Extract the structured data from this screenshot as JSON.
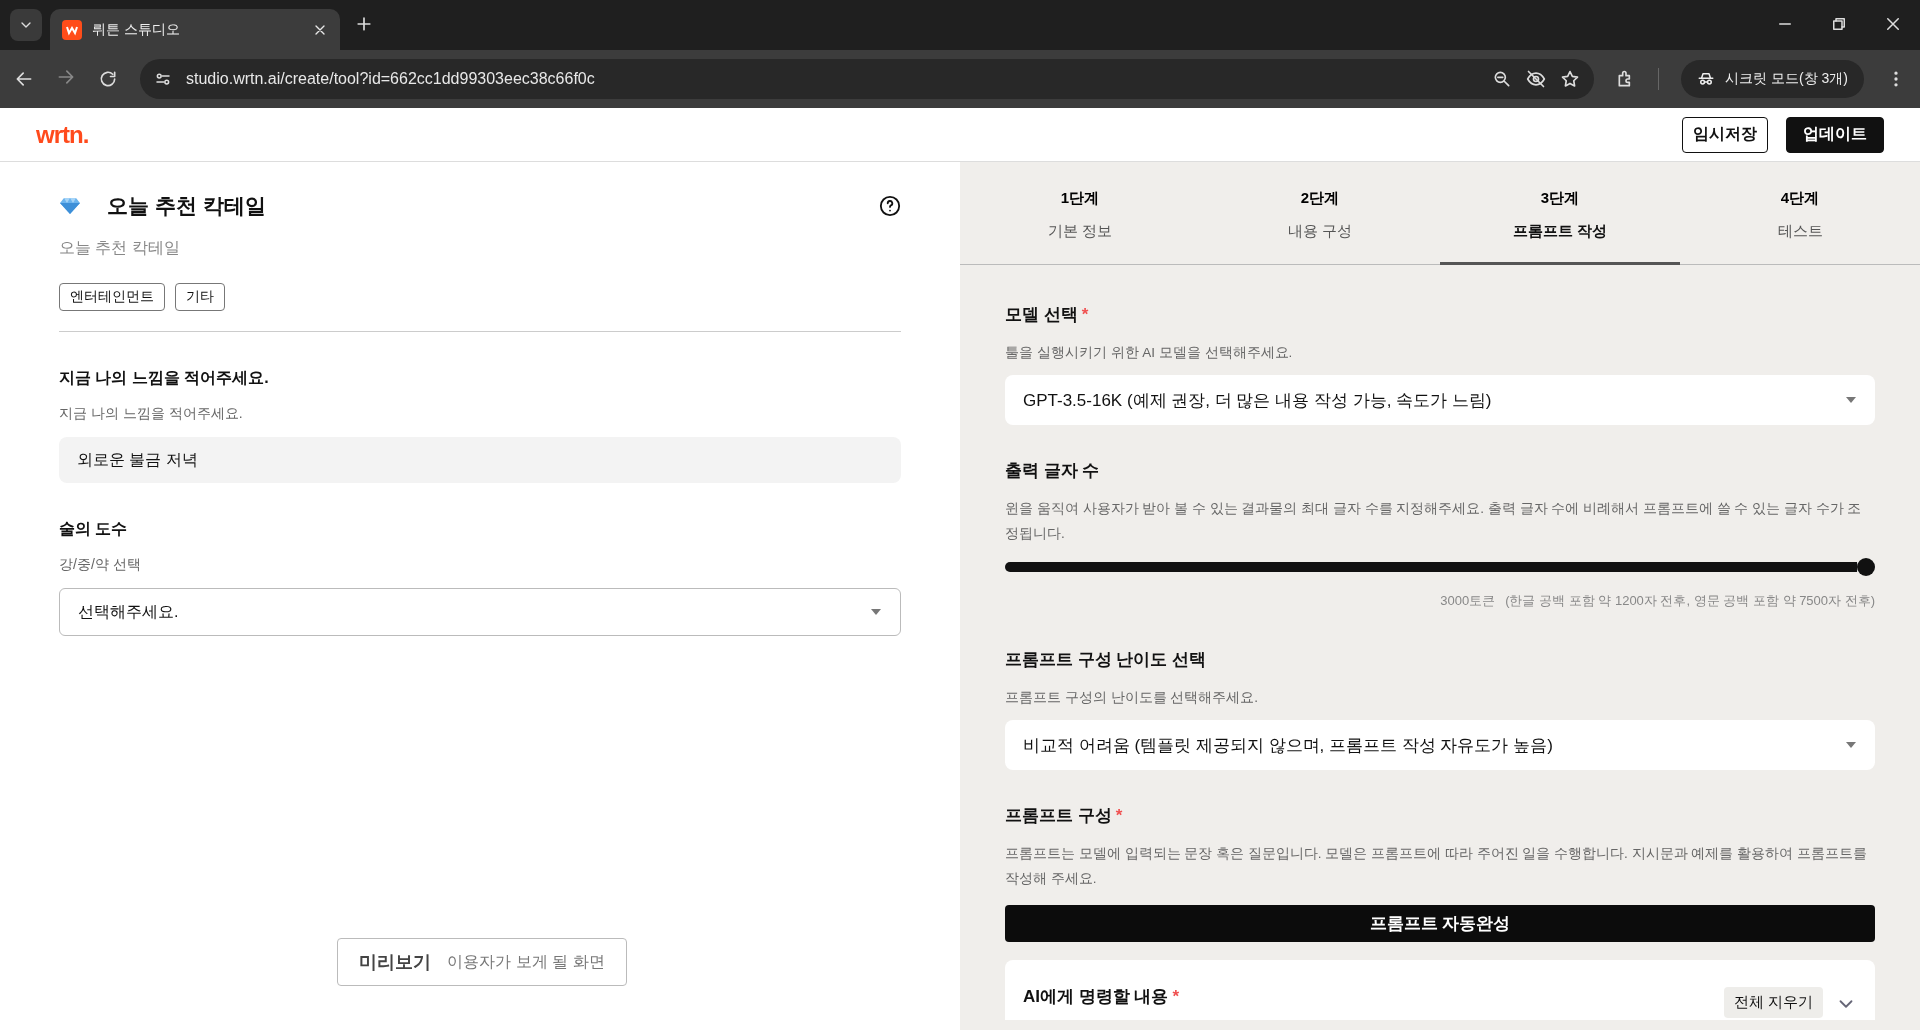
{
  "browser": {
    "tab_title": "뤼튼 스튜디오",
    "url": "studio.wrtn.ai/create/tool?id=662cc1dd99303eec38c66f0c",
    "incognito": "시크릿 모드(창 3개)"
  },
  "header": {
    "logo": "wrtn.",
    "buttons": [
      {
        "label": "임시저장",
        "kind": "outline"
      },
      {
        "label": "업데이트",
        "kind": "solid"
      }
    ]
  },
  "tool": {
    "title": "오늘 추천 칵테일",
    "subtitle": "오늘 추천 칵테일",
    "tags": [
      "엔터테인먼트",
      "기타"
    ],
    "fields": [
      {
        "kind": "text",
        "label": "지금 나의 느낌을 적어주세요.",
        "hint": "지금 나의 느낌을 적어주세요.",
        "value": "외로운 불금 저녁"
      },
      {
        "kind": "select",
        "label": "술의 도수",
        "hint": "강/중/약 선택",
        "placeholder": "선택해주세요."
      }
    ],
    "preview": {
      "label": "미리보기",
      "hint": "이용자가 보게 될 화면"
    }
  },
  "steps": [
    {
      "step": "1단계",
      "name": "기본 정보",
      "selected": false
    },
    {
      "step": "2단계",
      "name": "내용 구성",
      "selected": false
    },
    {
      "step": "3단계",
      "name": "프롬프트 작성",
      "selected": true
    },
    {
      "step": "4단계",
      "name": "테스트",
      "selected": false
    }
  ],
  "model": {
    "label": "모델 선택",
    "required_mark": "*",
    "hint": "툴을 실행시키기 위한 AI 모델을 선택해주세요.",
    "value": "GPT-3.5-16K (예제 권장, 더 많은 내용 작성 가능, 속도가 느림)"
  },
  "output_length": {
    "label": "출력 글자 수",
    "hint": "윈을 움직여 사용자가 받아 볼 수 있는 결과물의 최대 글자 수를 지정해주세요. 출력 글자 수에 비례해서 프롬프트에 쓸 수 있는 글자 수가 조정됩니다.",
    "level": 1,
    "reading": "3000토큰",
    "reading_note": "(한글 공백 포함 약 1200자 전후, 영문 공백 포함 약 7500자 전후)"
  },
  "difficulty": {
    "label": "프롬프트 구성 난이도 선택",
    "hint": "프롬프트 구성의 난이도를 선택해주세요.",
    "value": "비교적 어려움 (템플릿 제공되지 않으며, 프롬프트 작성 자유도가 높음)"
  },
  "prompt": {
    "label": "프롬프트 구성",
    "required_mark": "*",
    "hint": "프롬프트는 모델에 입력되는 문장 혹은 질문입니다. 모델은 프롬프트에 따라 주어진 일을 수행합니다. 지시문과 예제를 활용하여 프롬프트를 작성해 주세요.",
    "button": "프롬프트 자동완성",
    "card": {
      "label": "AI에게 명령할 내용",
      "required_mark": "*",
      "clear_button": "전체 지우기"
    }
  }
}
